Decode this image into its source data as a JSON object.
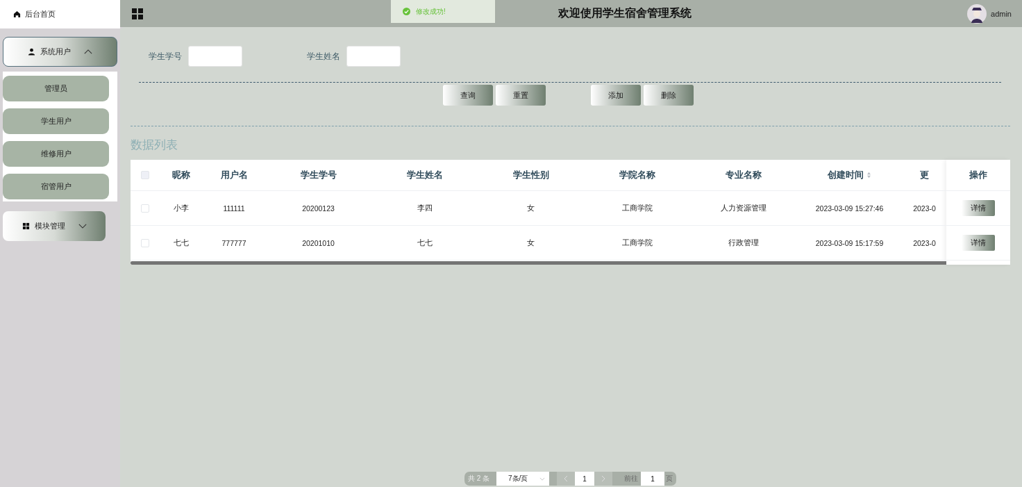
{
  "sidebar": {
    "home": {
      "label": "后台首页"
    },
    "menus": [
      {
        "label": "系统用户",
        "expanded": true,
        "children": [
          {
            "label": "管理员"
          },
          {
            "label": "学生用户"
          },
          {
            "label": "维修用户"
          },
          {
            "label": "宿管用户"
          }
        ]
      },
      {
        "label": "模块管理",
        "expanded": false
      }
    ]
  },
  "header": {
    "title": "欢迎使用学生宿舍管理系统",
    "user": "admin"
  },
  "toast": {
    "kind": "success",
    "message": "修改成功!"
  },
  "search": {
    "fields": [
      {
        "label": "学生学号"
      },
      {
        "label": "学生姓名"
      }
    ],
    "buttons": [
      {
        "label": "查询"
      },
      {
        "label": "重置"
      },
      {
        "label": "添加"
      },
      {
        "label": "删除"
      }
    ]
  },
  "table": {
    "title": "数据列表",
    "header_checked": false,
    "columns": [
      {
        "label": "昵称",
        "sortable": false
      },
      {
        "label": "用户名",
        "sortable": false
      },
      {
        "label": "学生学号",
        "sortable": false
      },
      {
        "label": "学生姓名",
        "sortable": false
      },
      {
        "label": "学生性别",
        "sortable": false
      },
      {
        "label": "学院名称",
        "sortable": false
      },
      {
        "label": "专业名称",
        "sortable": false
      },
      {
        "label": "创建时间",
        "sortable": true
      },
      {
        "label": "更",
        "sortable": false
      }
    ],
    "action_column": "操作",
    "rows": [
      {
        "checked": false,
        "cells": [
          "小李",
          "111111",
          "20200123",
          "李四",
          "女",
          "工商学院",
          "人力资源管理",
          "2023-03-09 15:27:46",
          "2023-0"
        ],
        "action": "详情"
      },
      {
        "checked": false,
        "cells": [
          "七七",
          "777777",
          "20201010",
          "七七",
          "女",
          "工商学院",
          "行政管理",
          "2023-03-09 15:17:59",
          "2023-0"
        ],
        "action": "详情"
      }
    ]
  },
  "pagination": {
    "total": "共 2 条",
    "page_size": "7条/页",
    "pages": [
      {
        "label": "1",
        "selected": true
      }
    ],
    "goto_label": "前往",
    "goto_value": "1",
    "page_suffix": "页"
  }
}
